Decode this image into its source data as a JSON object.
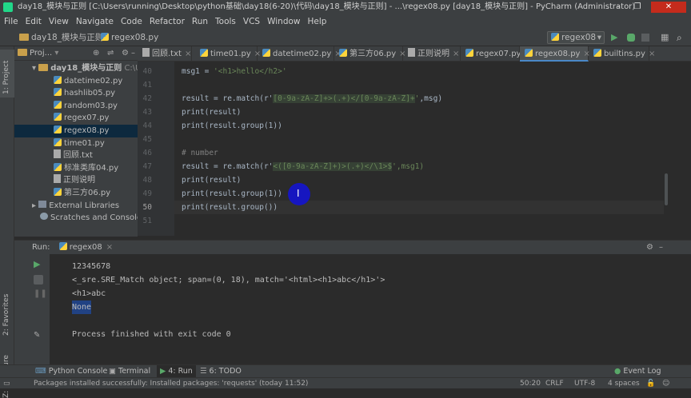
{
  "title": "day18_模块与正则 [C:\\Users\\running\\Desktop\\python基础\\day18(6-20)\\代码\\day18_模块与正则] - ...\\regex08.py [day18_模块与正则] - PyCharm (Administrator)",
  "menu": [
    "File",
    "Edit",
    "View",
    "Navigate",
    "Code",
    "Refactor",
    "Run",
    "Tools",
    "VCS",
    "Window",
    "Help"
  ],
  "nav": {
    "project": "day18_模块与正则",
    "file": "regex08.py",
    "run_config": "regex08"
  },
  "project": {
    "header": "Proj...",
    "root": "day18_模块与正则",
    "root_path": "C:\\Use",
    "files": [
      "datetime02.py",
      "hashlib05.py",
      "random03.py",
      "regex07.py",
      "regex08.py",
      "time01.py",
      "回顾.txt",
      "标准类库04.py",
      "正则说明",
      "第三方06.py"
    ],
    "external": "External Libraries",
    "scratches": "Scratches and Consoles"
  },
  "tabs": [
    "回顾.txt",
    "time01.py",
    "datetime02.py",
    "第三方06.py",
    "正则说明",
    "regex07.py",
    "regex08.py",
    "builtins.py"
  ],
  "line_numbers": [
    "40",
    "41",
    "42",
    "43",
    "44",
    "45",
    "46",
    "47",
    "48",
    "49",
    "50",
    "51"
  ],
  "code": {
    "l40_var": "msg1 = ",
    "l40_str": "'<h1>hello</h2>'",
    "l42_a": "result = re.match(r'",
    "l42_rx": "[0-9a-zA-Z]+>(.+)</[0-9a-zA-Z]+",
    "l42_b": "'",
    ",msg)": ",msg)",
    "l43": "print(result)",
    "l44": "print(result.group(1))",
    "l46": "# number",
    "l47_a": "result = re.match(r'",
    "l47_rx": "<([0-9a-zA-Z]+)>(.+)</\\1>$",
    "l47_b": "',msg1)",
    "l48": "print(result)",
    "l49": "print(result.group(1))",
    "l50": "print(result.group())"
  },
  "run": {
    "label": "Run:",
    "config": "regex08"
  },
  "console": [
    "12345678",
    "<_sre.SRE_Match object; span=(0, 18), match='<html><h1>abc</h1>'>",
    "<h1>abc",
    "None",
    "",
    "Process finished with exit code 0"
  ],
  "left_tabs": {
    "project": "1: Project",
    "favorites": "2: Favorites",
    "structure": "Z: Structure"
  },
  "bottom_tabs": [
    "Python Console",
    "Terminal",
    "4: Run",
    "6: TODO"
  ],
  "event_log": "Event Log",
  "status": {
    "message": "Packages installed successfully: Installed packages: 'requests' (today 11:52)",
    "position": "50:20",
    "line_sep": "CRLF",
    "encoding": "UTF-8",
    "indent": "4 spaces"
  }
}
